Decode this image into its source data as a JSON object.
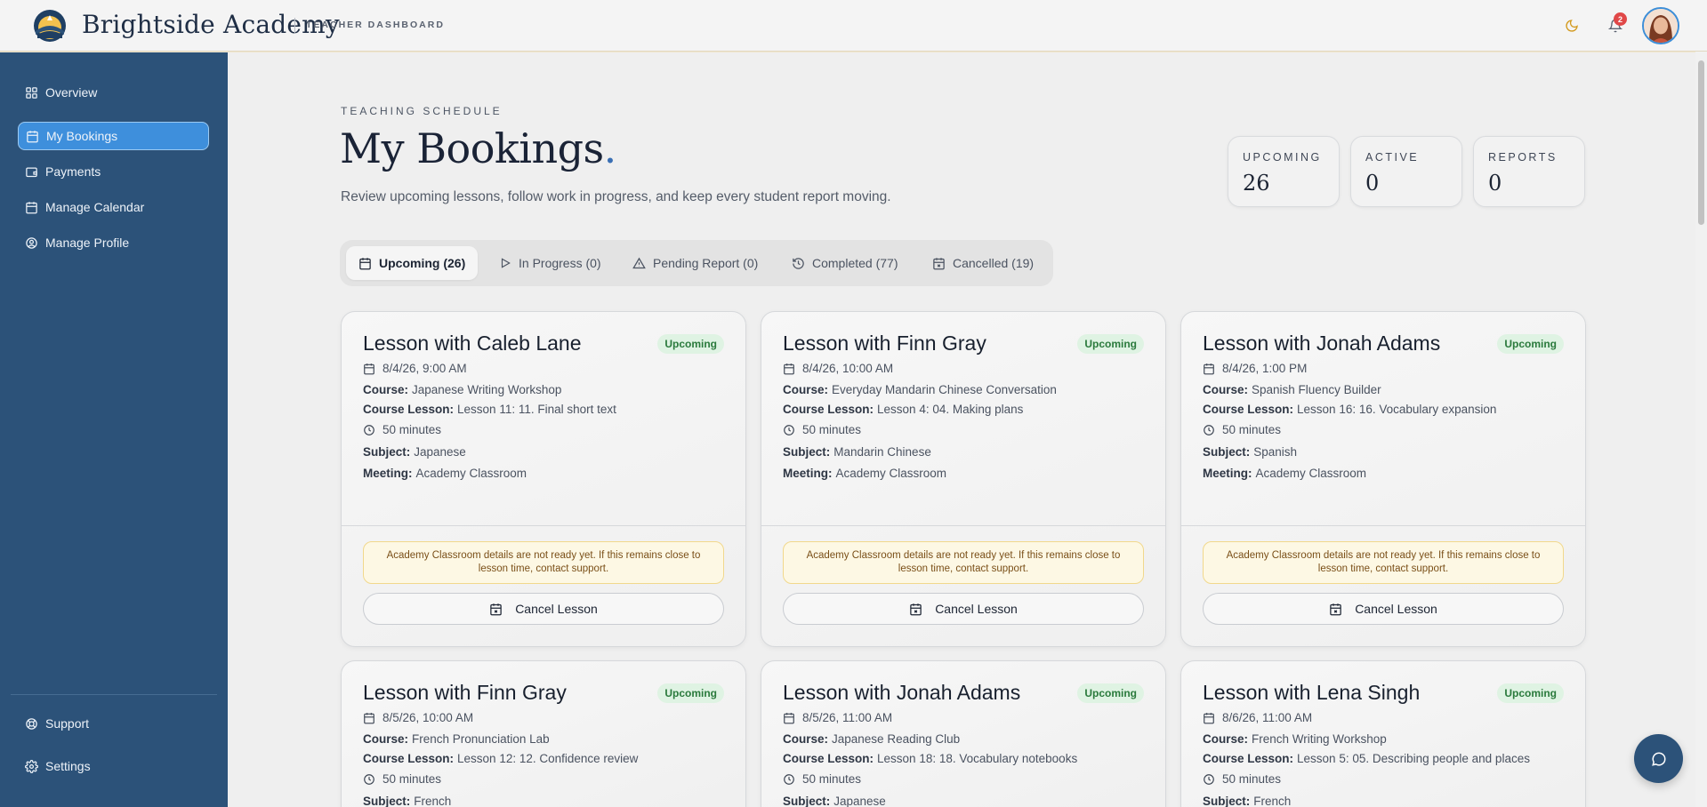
{
  "header": {
    "brand": "Brightside Academy",
    "subtitle": "TEACHER DASHBOARD",
    "notification_count": "2"
  },
  "sidebar": {
    "items": [
      {
        "label": "Overview",
        "icon": "grid-icon"
      },
      {
        "label": "My Bookings",
        "icon": "calendar-icon"
      },
      {
        "label": "Payments",
        "icon": "wallet-icon"
      },
      {
        "label": "Manage Calendar",
        "icon": "calendar-icon"
      },
      {
        "label": "Manage Profile",
        "icon": "user-circle-icon"
      }
    ],
    "bottom": [
      {
        "label": "Support",
        "icon": "lifebuoy-icon"
      },
      {
        "label": "Settings",
        "icon": "gear-icon"
      }
    ],
    "active_index": 1
  },
  "main": {
    "eyebrow": "TEACHING SCHEDULE",
    "title": "My Bookings",
    "title_dot": ".",
    "description": "Review upcoming lessons, follow work in progress, and keep every student report moving.",
    "stats": [
      {
        "label": "UPCOMING",
        "value": "26"
      },
      {
        "label": "ACTIVE",
        "value": "0"
      },
      {
        "label": "REPORTS",
        "value": "0"
      }
    ],
    "tabs": [
      {
        "label": "Upcoming (26)",
        "icon": "calendar-icon"
      },
      {
        "label": "In Progress (0)",
        "icon": "play-icon"
      },
      {
        "label": "Pending Report (0)",
        "icon": "warning-icon"
      },
      {
        "label": "Completed (77)",
        "icon": "history-icon"
      },
      {
        "label": "Cancelled (19)",
        "icon": "calendar-x-icon"
      }
    ]
  },
  "labels": {
    "course": "Course:",
    "course_lesson": "Course Lesson:",
    "subject": "Subject:",
    "meeting": "Meeting:",
    "warning": "Academy Classroom details are not ready yet. If this remains close to lesson time, contact support.",
    "cancel": "Cancel Lesson"
  },
  "cards": [
    {
      "title": "Lesson with Caleb Lane",
      "status": "Upcoming",
      "datetime": "8/4/26, 9:00 AM",
      "course": "Japanese Writing Workshop",
      "lesson": "Lesson 11: 11. Final short text",
      "duration": "50 minutes",
      "subject": "Japanese",
      "meeting": "Academy Classroom"
    },
    {
      "title": "Lesson with Finn Gray",
      "status": "Upcoming",
      "datetime": "8/4/26, 10:00 AM",
      "course": "Everyday Mandarin Chinese Conversation",
      "lesson": "Lesson 4: 04. Making plans",
      "duration": "50 minutes",
      "subject": "Mandarin Chinese",
      "meeting": "Academy Classroom"
    },
    {
      "title": "Lesson with Jonah Adams",
      "status": "Upcoming",
      "datetime": "8/4/26, 1:00 PM",
      "course": "Spanish Fluency Builder",
      "lesson": "Lesson 16: 16. Vocabulary expansion",
      "duration": "50 minutes",
      "subject": "Spanish",
      "meeting": "Academy Classroom"
    },
    {
      "title": "Lesson with Finn Gray",
      "status": "Upcoming",
      "datetime": "8/5/26, 10:00 AM",
      "course": "French Pronunciation Lab",
      "lesson": "Lesson 12: 12. Confidence review",
      "duration": "50 minutes",
      "subject": "French"
    },
    {
      "title": "Lesson with Jonah Adams",
      "status": "Upcoming",
      "datetime": "8/5/26, 11:00 AM",
      "course": "Japanese Reading Club",
      "lesson": "Lesson 18: 18. Vocabulary notebooks",
      "duration": "50 minutes",
      "subject": "Japanese"
    },
    {
      "title": "Lesson with Lena Singh",
      "status": "Upcoming",
      "datetime": "8/6/26, 11:00 AM",
      "course": "French Writing Workshop",
      "lesson": "Lesson 5: 05. Describing people and places",
      "duration": "50 minutes",
      "subject": "French"
    }
  ]
}
